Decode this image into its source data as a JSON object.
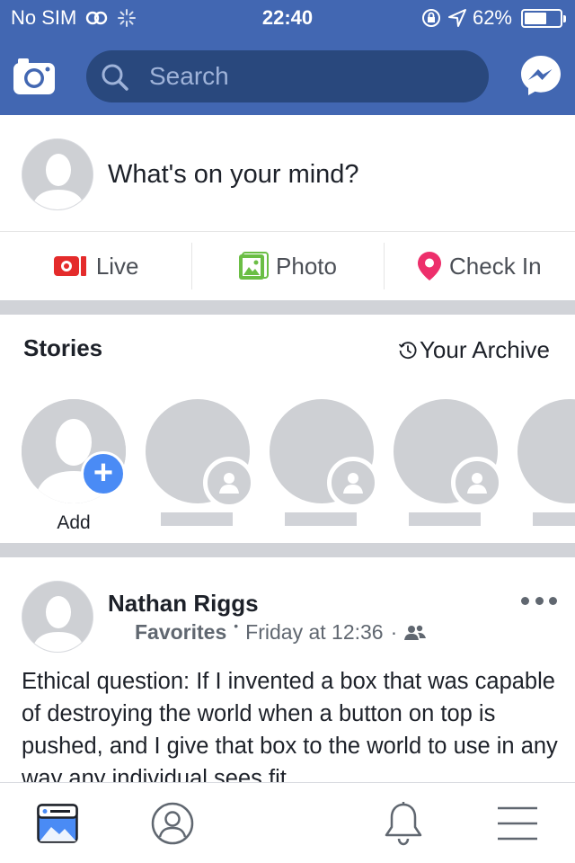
{
  "status_bar": {
    "carrier": "No SIM",
    "time": "22:40",
    "battery_percent": "62%",
    "battery_level": 0.62
  },
  "header": {
    "search_placeholder": "Search",
    "color": "#4267b2",
    "search_bg": "#29487d"
  },
  "composer": {
    "prompt": "What's on your mind?",
    "actions": [
      {
        "label": "Live",
        "icon": "live-video-icon",
        "color": "#e42b2b"
      },
      {
        "label": "Photo",
        "icon": "photo-icon",
        "color": "#6bbe45"
      },
      {
        "label": "Check In",
        "icon": "location-pin-icon",
        "color": "#ed2f6b"
      }
    ]
  },
  "stories": {
    "title": "Stories",
    "archive_label": "Your Archive",
    "add_label": "Add"
  },
  "post": {
    "author": "Nathan Riggs",
    "group": "Favorites",
    "time": "Friday at 12:36",
    "audience_icon": "friends-icon",
    "text": "Ethical question: If I invented a box that was capable of destroying the world when a button on top is pushed, and I give that box to the world to use in any way any individual sees fit"
  },
  "tabbar": {
    "items": [
      "news-feed-icon",
      "profile-icon",
      "notifications-bell-icon",
      "menu-icon"
    ]
  }
}
